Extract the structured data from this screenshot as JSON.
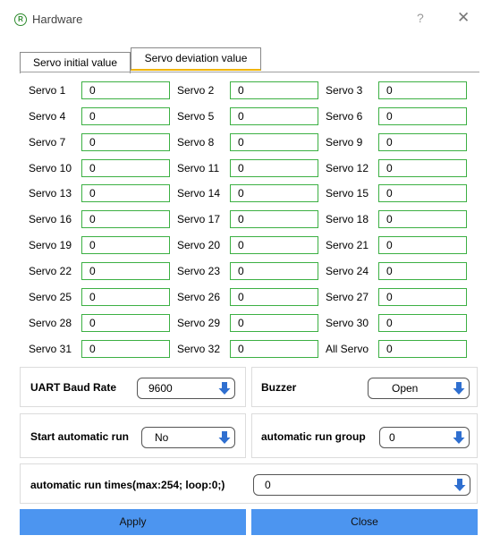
{
  "window": {
    "icon_text": "R",
    "title": "Hardware",
    "help_label": "?",
    "close_label": "✕"
  },
  "tabs": [
    {
      "label": "Servo initial value",
      "active": false
    },
    {
      "label": "Servo deviation value",
      "active": true
    }
  ],
  "servos": [
    {
      "label": "Servo 1",
      "value": "0"
    },
    {
      "label": "Servo 2",
      "value": "0"
    },
    {
      "label": "Servo 3",
      "value": "0"
    },
    {
      "label": "Servo 4",
      "value": "0"
    },
    {
      "label": "Servo 5",
      "value": "0"
    },
    {
      "label": "Servo 6",
      "value": "0"
    },
    {
      "label": "Servo 7",
      "value": "0"
    },
    {
      "label": "Servo 8",
      "value": "0"
    },
    {
      "label": "Servo 9",
      "value": "0"
    },
    {
      "label": "Servo 10",
      "value": "0"
    },
    {
      "label": "Servo 11",
      "value": "0"
    },
    {
      "label": "Servo 12",
      "value": "0"
    },
    {
      "label": "Servo 13",
      "value": "0"
    },
    {
      "label": "Servo 14",
      "value": "0"
    },
    {
      "label": "Servo 15",
      "value": "0"
    },
    {
      "label": "Servo 16",
      "value": "0"
    },
    {
      "label": "Servo 17",
      "value": "0"
    },
    {
      "label": "Servo 18",
      "value": "0"
    },
    {
      "label": "Servo 19",
      "value": "0"
    },
    {
      "label": "Servo 20",
      "value": "0"
    },
    {
      "label": "Servo 21",
      "value": "0"
    },
    {
      "label": "Servo 22",
      "value": "0"
    },
    {
      "label": "Servo 23",
      "value": "0"
    },
    {
      "label": "Servo 24",
      "value": "0"
    },
    {
      "label": "Servo 25",
      "value": "0"
    },
    {
      "label": "Servo 26",
      "value": "0"
    },
    {
      "label": "Servo 27",
      "value": "0"
    },
    {
      "label": "Servo 28",
      "value": "0"
    },
    {
      "label": "Servo 29",
      "value": "0"
    },
    {
      "label": "Servo 30",
      "value": "0"
    },
    {
      "label": "Servo 31",
      "value": "0"
    },
    {
      "label": "Servo 32",
      "value": "0"
    },
    {
      "label": "All Servo",
      "value": "0"
    }
  ],
  "settings": {
    "baud_rate": {
      "label": "UART Baud Rate",
      "value": "9600"
    },
    "buzzer": {
      "label": "Buzzer",
      "value": "Open"
    },
    "auto_run": {
      "label": "Start automatic run",
      "value": "No"
    },
    "auto_run_group": {
      "label": "automatic run group",
      "value": "0"
    },
    "auto_run_times": {
      "label": "automatic run times(max:254; loop:0;)",
      "value": "0"
    }
  },
  "buttons": {
    "apply": "Apply",
    "close": "Close"
  },
  "colors": {
    "accent_blue": "#4c95f0",
    "input_border_green": "#3cb043",
    "tab_highlight": "#f0b400",
    "dropdown_icon": "#2f6fd0"
  }
}
